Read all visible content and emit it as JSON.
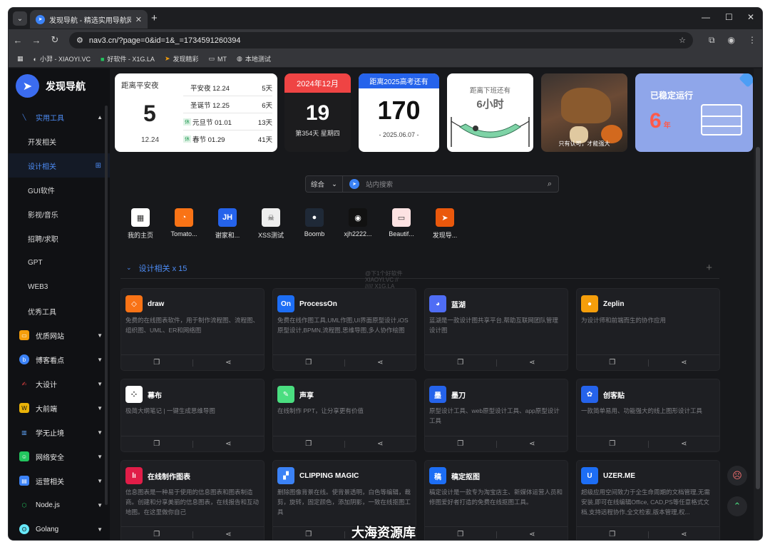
{
  "browser": {
    "tab_title": "发现导航 - 精选实用导航网站",
    "url": "nav3.cn/?page=0&id=1&_=1734591260394",
    "bookmarks": [
      "小羿 - XIAOYI.VC",
      "好软件 - X1G.LA",
      "发现精彩",
      "MT",
      "本地测试"
    ]
  },
  "sidebar": {
    "logo": "发现导航",
    "category_open": "实用工具",
    "subitems": [
      "开发相关",
      "设计相关",
      "GUI软件",
      "影视/音乐",
      "招聘/求职",
      "GPT",
      "WEB3",
      "优秀工具"
    ],
    "items": [
      "优质网站",
      "博客看点",
      "大设计",
      "大前端",
      "学无止境",
      "网络安全",
      "运营相关",
      "Node.js",
      "Golang"
    ]
  },
  "holiday_card": {
    "label": "距离平安夜",
    "days": "5",
    "date": "12.24",
    "rows": [
      {
        "tag": "",
        "name": "平安夜 12.24",
        "days": "5天"
      },
      {
        "tag": "",
        "name": "圣诞节 12.25",
        "days": "6天"
      },
      {
        "tag": "休",
        "name": "元旦节 01.01",
        "days": "13天"
      },
      {
        "tag": "休",
        "name": "春节 01.29",
        "days": "41天"
      }
    ]
  },
  "calendar_card": {
    "header": "2024年12月",
    "day": "19",
    "sub": "第354天 星期四"
  },
  "exam_card": {
    "header": "距离2025高考还有",
    "days": "170",
    "date": "- 2025.06.07 -"
  },
  "offwork_card": {
    "line1": "距离下班还有",
    "line2": "6小时"
  },
  "photo_card": {
    "caption": "只有认可，才能强大"
  },
  "uptime_card": {
    "title": "已稳定运行",
    "value": "6",
    "unit": "年"
  },
  "search": {
    "scope": "综合",
    "placeholder": "站内搜索"
  },
  "quick_links": [
    {
      "label": "我的主页",
      "icon": "grid-icon",
      "color": "#ffffff",
      "glyph": "▦"
    },
    {
      "label": "Tomato...",
      "icon": "tomato-icon",
      "color": "#f97316",
      "glyph": "◔"
    },
    {
      "label": "谢家和...",
      "icon": "jh-icon",
      "color": "#2563eb",
      "glyph": "JH"
    },
    {
      "label": "XSS测试",
      "icon": "hacker-icon",
      "color": "#eeeeee",
      "glyph": "☠"
    },
    {
      "label": "Boomb",
      "icon": "bomb-icon",
      "color": "#1f2937",
      "glyph": "●"
    },
    {
      "label": "xjh2222...",
      "icon": "github-icon",
      "color": "#111111",
      "glyph": "◉"
    },
    {
      "label": "Beautif...",
      "icon": "browser-icon",
      "color": "#fde2e2",
      "glyph": "▭"
    },
    {
      "label": "发现导...",
      "icon": "navigation-icon",
      "color": "#ea580c",
      "glyph": "➤"
    }
  ],
  "section": {
    "title": "设计相关 x 15",
    "watermark": "@下1个好软件\nXIAOYI.VC //\n///// X1G.LA"
  },
  "sites": [
    {
      "name": "draw",
      "desc": "免费的在线图表软件，用于制作流程图、流程图、组织图、UML、ER和网络图",
      "color": "#f97316",
      "glyph": "◇"
    },
    {
      "name": "ProcessOn",
      "desc": "免费在线作图工具,UML作图,UI界面原型设计,iOS原型设计,BPMN,流程图,思维导图,多人协作绘图",
      "color": "#1d6ef5",
      "glyph": "On"
    },
    {
      "name": "蓝湖",
      "desc": "蓝湖是一款设计图共享平台,帮助互联网团队管理设计图",
      "color": "#4f6df5",
      "glyph": "◕"
    },
    {
      "name": "Zeplin",
      "desc": "为设计师和前端而生的协作应用",
      "color": "#f59e0b",
      "glyph": "●"
    },
    {
      "name": "幕布",
      "desc": "极简大纲笔记 | 一键生成思维导图",
      "color": "#ffffff",
      "glyph": "⁘"
    },
    {
      "name": "声享",
      "desc": "在线制作 PPT，让分享更有价值",
      "color": "#4ade80",
      "glyph": "✎"
    },
    {
      "name": "墨刀",
      "desc": "原型设计工具、web原型设计工具、app原型设计工具",
      "color": "#2563eb",
      "glyph": "墨"
    },
    {
      "name": "创客贴",
      "desc": "一款简单易用、功能强大的线上图形设计工具",
      "color": "#2563eb",
      "glyph": "✿"
    },
    {
      "name": "在线制作图表",
      "desc": "信息图表是一种易于使用的信息图表和图表制造商。创建和分享美丽的信息图表，在线报告和互动地图。在这里做你自己",
      "color": "#e11d48",
      "glyph": "lı"
    },
    {
      "name": "CLIPPING MAGIC",
      "desc": "删除图像背景在线。使背景透明，白色等编辑，裁剪，旋转，固定颜色，添加阴影，一致在线抠图工具",
      "color": "#3b82f6",
      "glyph": "▞"
    },
    {
      "name": "稿定抠图",
      "desc": "稿定设计是一款专为淘宝店主、新媒体运营人员和修图爱好者打造的免费在线抠图工具。",
      "color": "#1d6ef5",
      "glyph": "稿"
    },
    {
      "name": "UZER.ME",
      "desc": "超级应用空间致力于全生命周期的文档管理,无需安装,即可在线编辑Office, CAD,PS等任意格式文档,支持远程协作,全文检索,版本管理,权...",
      "color": "#1d6ef5",
      "glyph": "U"
    }
  ],
  "bottom_watermark": "大海资源库"
}
